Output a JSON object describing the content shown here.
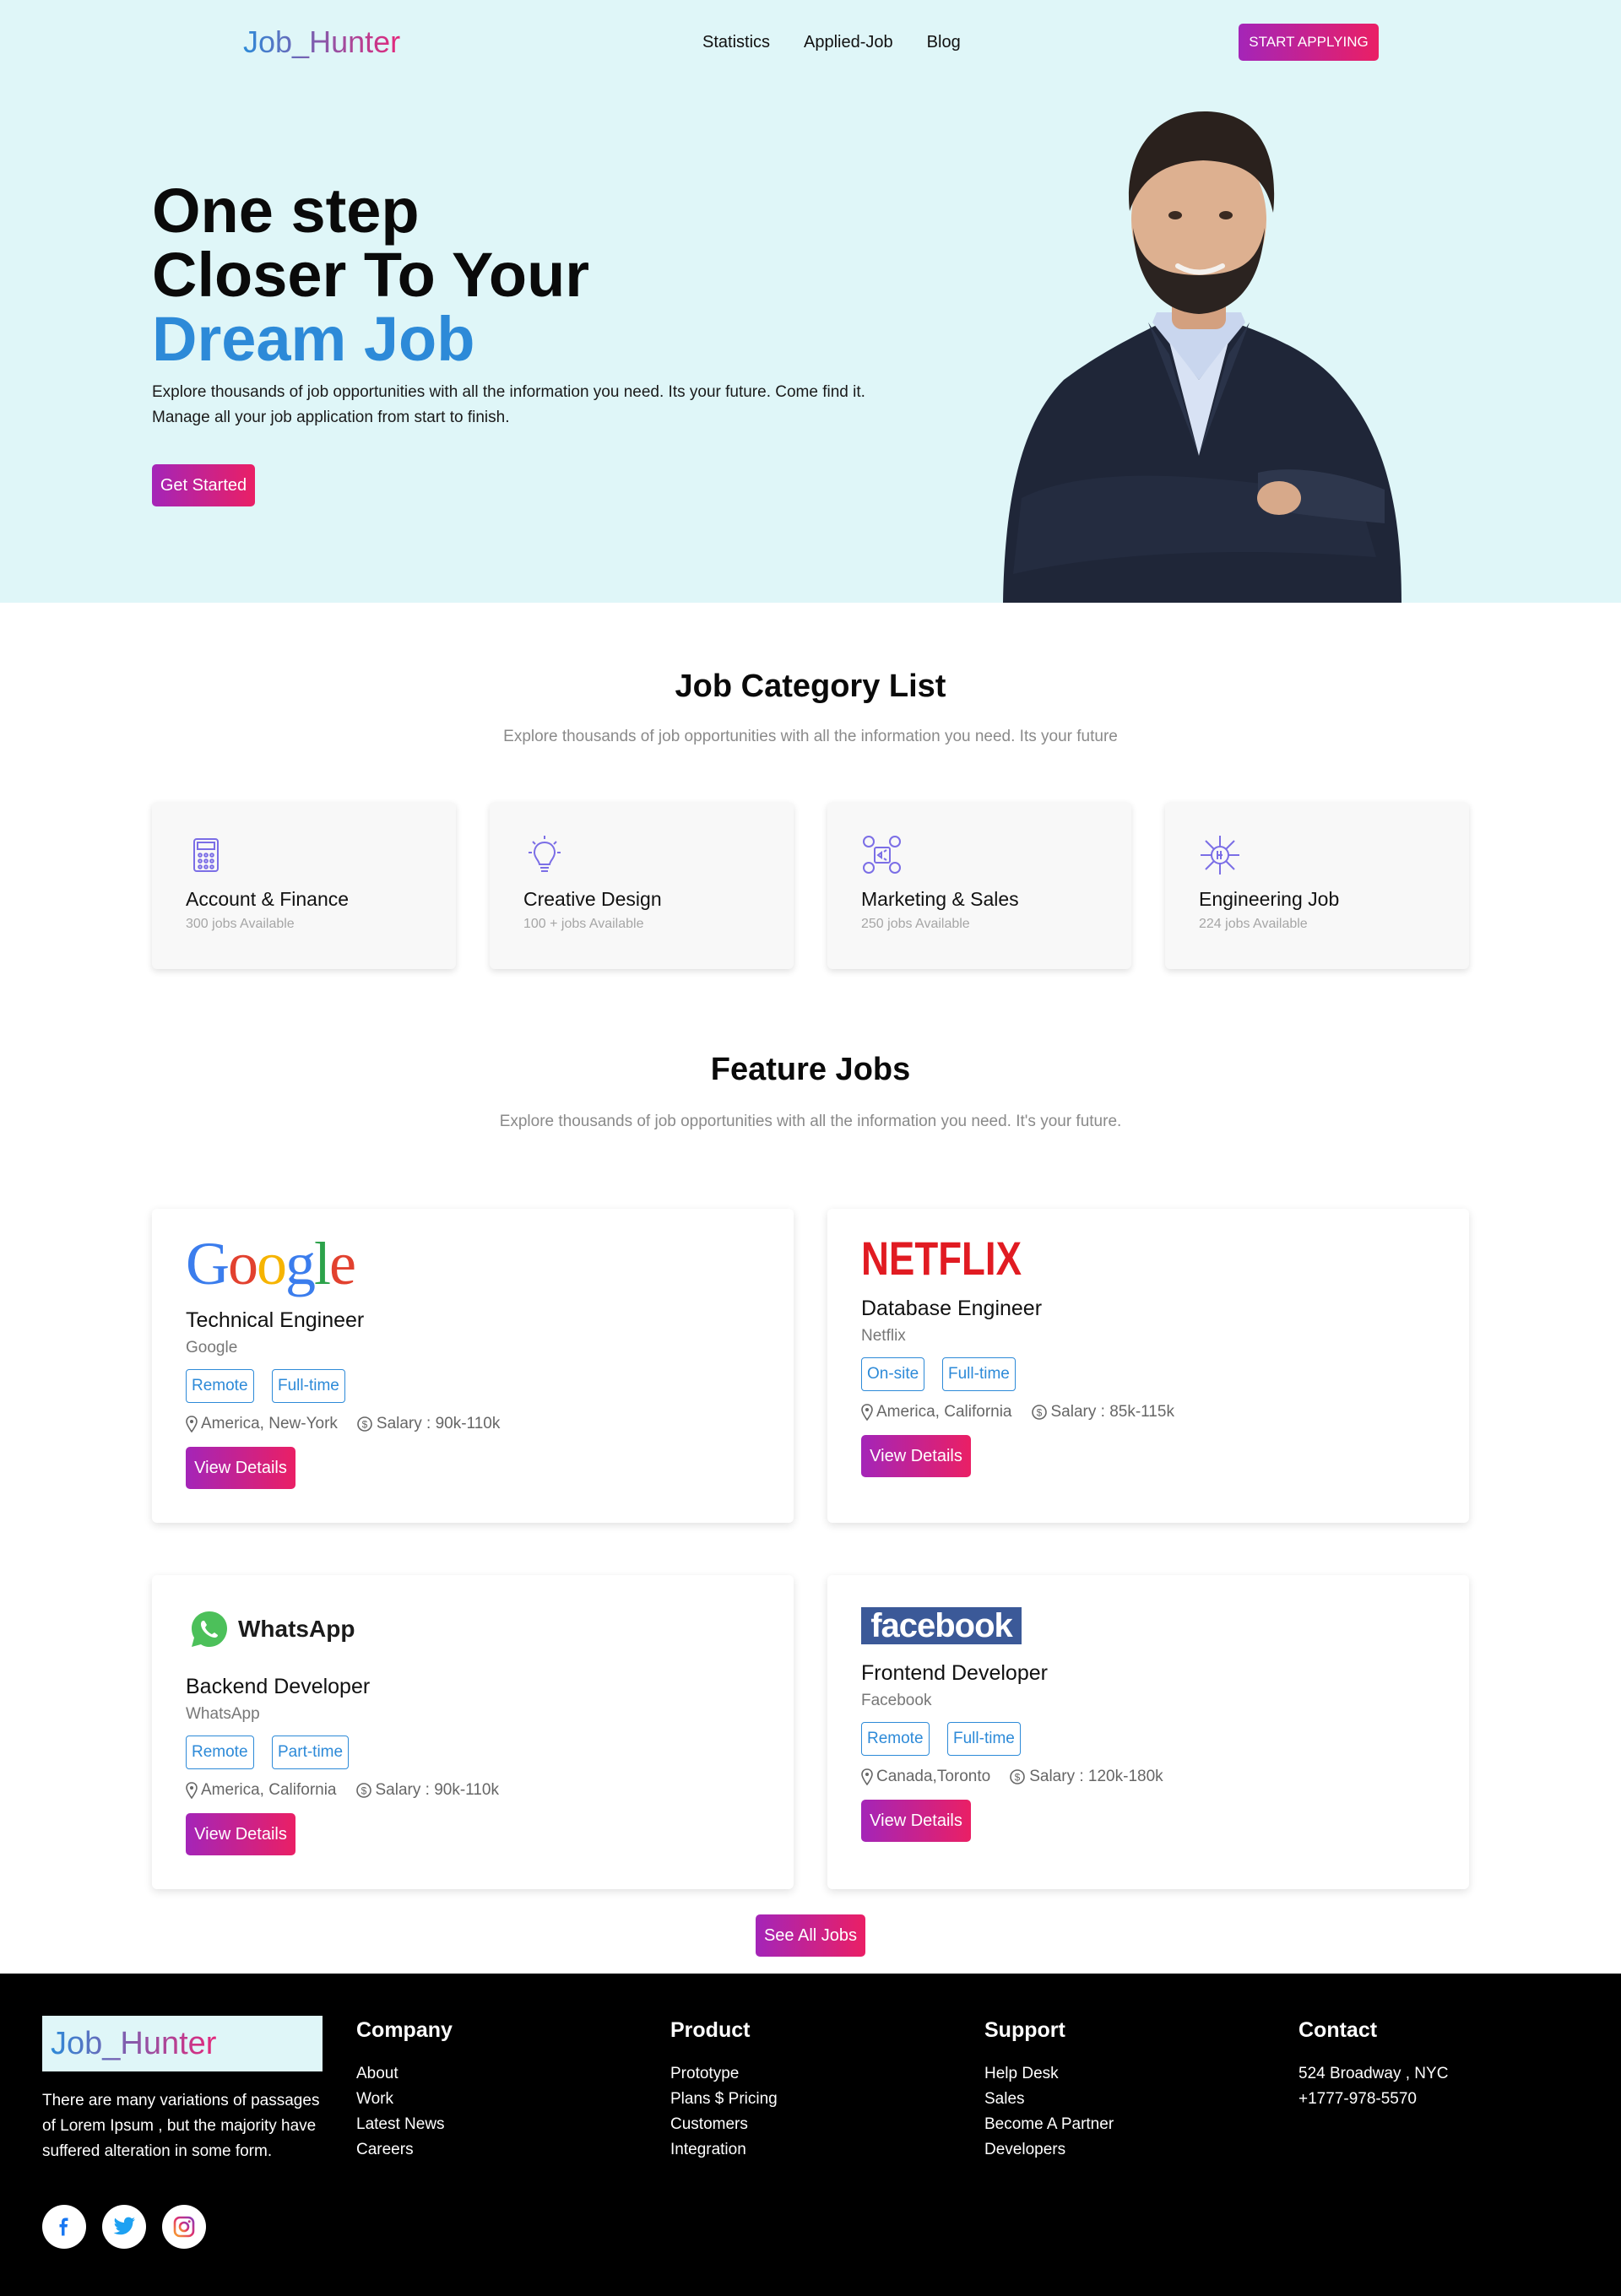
{
  "header": {
    "logo": "Job_Hunter",
    "nav": [
      "Statistics",
      "Applied-Job",
      "Blog"
    ],
    "cta": "START APPLYING"
  },
  "hero": {
    "line1": "One step",
    "line2": "Closer To Your",
    "line3": "Dream Job",
    "description": "Explore thousands of job opportunities with all the information you need. Its your future. Come find it. Manage all your job application from start to finish.",
    "button": "Get Started"
  },
  "categories": {
    "title": "Job Category List",
    "subtitle": "Explore thousands of job opportunities with all the information you need. Its your future",
    "items": [
      {
        "name": "Account & Finance",
        "count": "300 jobs Available",
        "icon": "calculator-icon"
      },
      {
        "name": "Creative Design",
        "count": "100 + jobs Available",
        "icon": "lightbulb-icon"
      },
      {
        "name": "Marketing & Sales",
        "count": "250 jobs Available",
        "icon": "marketing-icon"
      },
      {
        "name": "Engineering Job",
        "count": "224 jobs Available",
        "icon": "chip-icon"
      }
    ]
  },
  "features": {
    "title": "Feature Jobs",
    "subtitle": "Explore thousands of job opportunities with all the information you need. It's your future.",
    "jobs": [
      {
        "logo": "Google",
        "title": "Technical Engineer",
        "company": "Google",
        "tags": [
          "Remote",
          "Full-time"
        ],
        "location": "America, New-York",
        "salary": "Salary : 90k-110k",
        "button": "View Details"
      },
      {
        "logo": "NETFLIX",
        "title": "Database Engineer",
        "company": "Netflix",
        "tags": [
          "On-site",
          "Full-time"
        ],
        "location": "America, California",
        "salary": "Salary : 85k-115k",
        "button": "View Details"
      },
      {
        "logo": "WhatsApp",
        "title": "Backend Developer",
        "company": "WhatsApp",
        "tags": [
          "Remote",
          "Part-time"
        ],
        "location": "America, California",
        "salary": "Salary : 90k-110k",
        "button": "View Details"
      },
      {
        "logo": "facebook",
        "title": "Frontend Developer",
        "company": "Facebook",
        "tags": [
          "Remote",
          "Full-time"
        ],
        "location": "Canada,Toronto",
        "salary": "Salary : 120k-180k",
        "button": "View Details"
      }
    ],
    "see_all": "See All Jobs"
  },
  "footer": {
    "logo": "Job_Hunter",
    "text": "There are many variations of passages of Lorem Ipsum , but the majority have suffered alteration in some form.",
    "columns": [
      {
        "title": "Company",
        "links": [
          "About",
          "Work",
          "Latest News",
          "Careers"
        ]
      },
      {
        "title": "Product",
        "links": [
          "Prototype",
          "Plans $ Pricing",
          "Customers",
          "Integration"
        ]
      },
      {
        "title": "Support",
        "links": [
          "Help Desk",
          "Sales",
          "Become A Partner",
          "Developers"
        ]
      },
      {
        "title": "Contact",
        "links": [
          "524 Broadway , NYC",
          "+1777-978-5570"
        ]
      }
    ],
    "social": [
      "facebook-icon",
      "twitter-icon",
      "instagram-icon"
    ]
  },
  "colors": {
    "accent_blue": "#2d8ad8",
    "gradient_start": "#a425b8",
    "gradient_end": "#ea1f65",
    "hero_bg": "#dff6f8"
  }
}
